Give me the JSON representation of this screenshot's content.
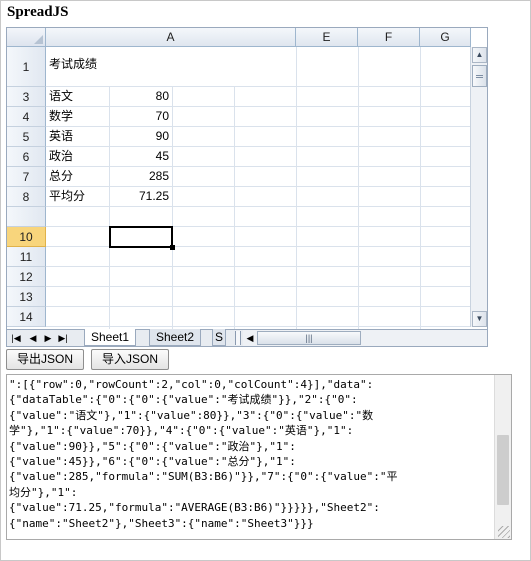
{
  "app_title": "SpreadJS",
  "columns": [
    "A",
    "E",
    "F",
    "G"
  ],
  "rows": [
    "1",
    "3",
    "4",
    "5",
    "6",
    "7",
    "8",
    "10",
    "11",
    "12",
    "13",
    "14"
  ],
  "active_row": "10",
  "cells": {
    "a1": "考试成绩",
    "a3": "语文",
    "b3": "80",
    "a4": "数学",
    "b4": "70",
    "a5": "英语",
    "b5": "90",
    "a6": "政治",
    "b6": "45",
    "a7": "总分",
    "b7": "285",
    "a8": "平均分",
    "b8": "71.25"
  },
  "tabs": {
    "sheet1": "Sheet1",
    "sheet2": "Sheet2",
    "sheet3_partial": "S"
  },
  "nav_icons": [
    "first-sheet-icon",
    "prev-sheet-icon",
    "next-sheet-icon",
    "last-sheet-icon"
  ],
  "buttons": {
    "export": "导出JSON",
    "import": "导入JSON"
  },
  "json_text": "\":[{\"row\":0,\"rowCount\":2,\"col\":0,\"colCount\":4}],\"data\":\n{\"dataTable\":{\"0\":{\"0\":{\"value\":\"考试成绩\"}},\"2\":{\"0\":\n{\"value\":\"语文\"},\"1\":{\"value\":80}},\"3\":{\"0\":{\"value\":\"数\n学\"},\"1\":{\"value\":70}},\"4\":{\"0\":{\"value\":\"英语\"},\"1\":\n{\"value\":90}},\"5\":{\"0\":{\"value\":\"政治\"},\"1\":\n{\"value\":45}},\"6\":{\"0\":{\"value\":\"总分\"},\"1\":\n{\"value\":285,\"formula\":\"SUM(B3:B6)\"}},\"7\":{\"0\":{\"value\":\"平\n均分\"},\"1\":\n{\"value\":71.25,\"formula\":\"AVERAGE(B3:B6)\"}}}}},\"Sheet2\":\n{\"name\":\"Sheet2\"},\"Sheet3\":{\"name\":\"Sheet3\"}}}"
}
